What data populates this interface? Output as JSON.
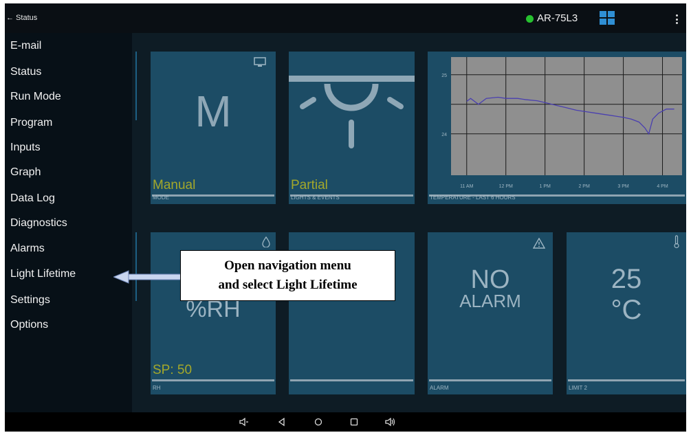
{
  "topbar": {
    "back_label": "← Status",
    "device_name": "AR-75L3",
    "status_color": "#26c12f",
    "icons": [
      "dashboard-grid-icon",
      "overflow-menu-icon"
    ]
  },
  "nav": {
    "items": [
      "E-mail",
      "Status",
      "Run Mode",
      "Program",
      "Inputs",
      "Graph",
      "Data Log",
      "Diagnostics",
      "Alarms",
      "Light Lifetime",
      "Settings",
      "Options"
    ]
  },
  "tiles": {
    "mode": {
      "value": "M",
      "status": "Manual",
      "label": "MODE"
    },
    "lights": {
      "status": "Partial",
      "label": "LIGHTS & EVENTS"
    },
    "temperature_chart": {
      "label": "TEMPERATURE - LAST 6 HOURS"
    },
    "rh": {
      "value": "%RH",
      "setpoint": "SP: 50",
      "label": "RH"
    },
    "alarm": {
      "line1": "NO",
      "line2": "ALARM",
      "label": "ALARM"
    },
    "limit2": {
      "value": "25",
      "unit": "°C",
      "label": "LIMIT 2"
    }
  },
  "chart_data": {
    "type": "line",
    "title": "",
    "xlabel": "",
    "ylabel": "",
    "x_ticks": [
      "11 AM",
      "12 PM",
      "1 PM",
      "2 PM",
      "3 PM",
      "4 PM"
    ],
    "y_ticks": [
      "24",
      "25"
    ],
    "ylim": [
      23.3,
      25.3
    ],
    "grid": true,
    "series": [
      {
        "color": "#4a3fb0",
        "x": [
          0,
          0.1,
          0.3,
          0.5,
          0.8,
          1.0,
          1.3,
          1.5,
          1.8,
          2.0,
          2.3,
          2.5,
          2.8,
          3.0,
          3.3,
          3.5,
          3.8,
          4.0,
          4.2,
          4.4,
          4.55,
          4.65,
          4.75,
          4.9,
          5.1,
          5.3
        ],
        "y": [
          24.55,
          24.6,
          24.5,
          24.6,
          24.62,
          24.6,
          24.6,
          24.58,
          24.56,
          24.53,
          24.48,
          24.45,
          24.4,
          24.38,
          24.35,
          24.33,
          24.3,
          24.28,
          24.25,
          24.2,
          24.1,
          24.0,
          24.25,
          24.35,
          24.42,
          24.42
        ]
      }
    ]
  },
  "annotation": {
    "line1": "Open navigation menu",
    "line2": "and select Light Lifetime"
  },
  "bottombar": {
    "icons": [
      "volume-down-icon",
      "back-icon",
      "home-icon",
      "recents-icon",
      "volume-up-icon"
    ]
  }
}
